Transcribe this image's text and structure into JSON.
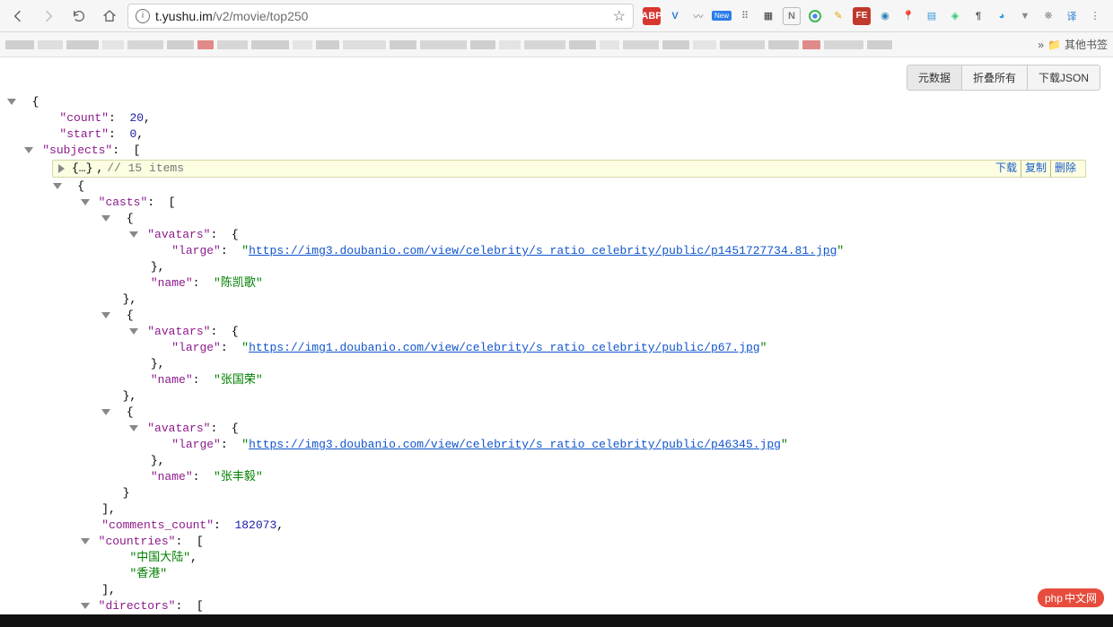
{
  "browser": {
    "url_domain": "t.yushu.im",
    "url_path": "/v2/movie/top250",
    "bookmarks_other": "其他书签",
    "more": "»"
  },
  "json_viewer": {
    "buttons": {
      "meta": "元数据",
      "collapse": "折叠所有",
      "download": "下载JSON"
    },
    "row_actions": {
      "download": "下载",
      "copy": "复制",
      "delete": "删除"
    }
  },
  "tree": {
    "count_key": "\"count\"",
    "count_val": "20",
    "start_key": "\"start\"",
    "start_val": "0",
    "subjects_key": "\"subjects\"",
    "collapsed_hint": "// 15 items",
    "collapsed_obj": "{…}",
    "casts_key": "\"casts\"",
    "avatars_key": "\"avatars\"",
    "large_key": "\"large\"",
    "name_key": "\"name\"",
    "comments_count_key": "\"comments_count\"",
    "comments_count_val": "182073",
    "countries_key": "\"countries\"",
    "directors_key": "\"directors\"",
    "casts": [
      {
        "large": "https://img3.doubanio.com/view/celebrity/s_ratio_celebrity/public/p1451727734.81.jpg",
        "name": "\"陈凯歌\""
      },
      {
        "large": "https://img1.doubanio.com/view/celebrity/s_ratio_celebrity/public/p67.jpg",
        "name": "\"张国荣\""
      },
      {
        "large": "https://img3.doubanio.com/view/celebrity/s_ratio_celebrity/public/p46345.jpg",
        "name": "\"张丰毅\""
      }
    ],
    "countries": [
      "\"中国大陆\"",
      "\"香港\""
    ]
  },
  "watermark": {
    "prefix": "php",
    "text": "中文网"
  }
}
